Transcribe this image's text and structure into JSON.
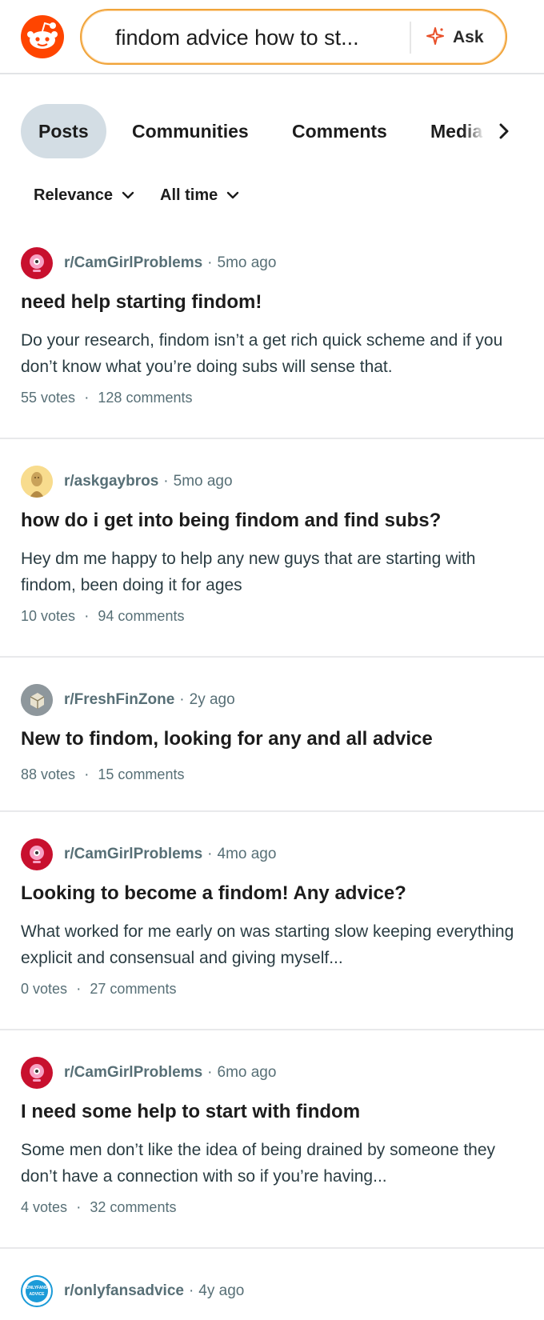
{
  "search": {
    "query": "findom advice how to st...",
    "ask_label": "Ask"
  },
  "tabs": [
    {
      "label": "Posts"
    },
    {
      "label": "Communities"
    },
    {
      "label": "Comments"
    },
    {
      "label": "Media"
    }
  ],
  "filters": {
    "sort": "Relevance",
    "time": "All time"
  },
  "posts": [
    {
      "subreddit": "r/CamGirlProblems",
      "age": "5mo ago",
      "title": "need help starting findom!",
      "snippet": "Do your research, findom isn’t a get rich quick scheme and if you don’t know what you’re doing subs will sense that.",
      "votes": "55 votes",
      "comments": "128 comments"
    },
    {
      "subreddit": "r/askgaybros",
      "age": "5mo ago",
      "title": "how do i get into being findom and find subs?",
      "snippet": "Hey dm me happy to help any new guys that are starting with findom, been doing it for ages",
      "votes": "10 votes",
      "comments": "94 comments"
    },
    {
      "subreddit": "r/FreshFinZone",
      "age": "2y ago",
      "title": "New to findom, looking for any and all advice",
      "votes": "88 votes",
      "comments": "15 comments"
    },
    {
      "subreddit": "r/CamGirlProblems",
      "age": "4mo ago",
      "title": "Looking to become a findom! Any advice?",
      "snippet": "What worked for me early on was starting slow keeping everything explicit and consensual and giving myself...",
      "votes": "0 votes",
      "comments": "27 comments"
    },
    {
      "subreddit": "r/CamGirlProblems",
      "age": "6mo ago",
      "title": "I need some help to start with findom",
      "snippet": "Some men don’t like the idea of being drained by someone they don’t have a connection with so if you’re having...",
      "votes": "4 votes",
      "comments": "32 comments"
    },
    {
      "subreddit": "r/onlyfansadvice",
      "age": "4y ago",
      "avatar_text": "ONLYFANS ADVICE"
    }
  ],
  "separator": "·",
  "colors": {
    "accent": "#ff4500",
    "meta": "#576f76",
    "tab_active_bg": "#d3dde4"
  },
  "icons": [
    "reddit-logo-icon",
    "sparkle-icon",
    "chevron-right-icon",
    "chevron-down-icon",
    "webcam-icon"
  ]
}
